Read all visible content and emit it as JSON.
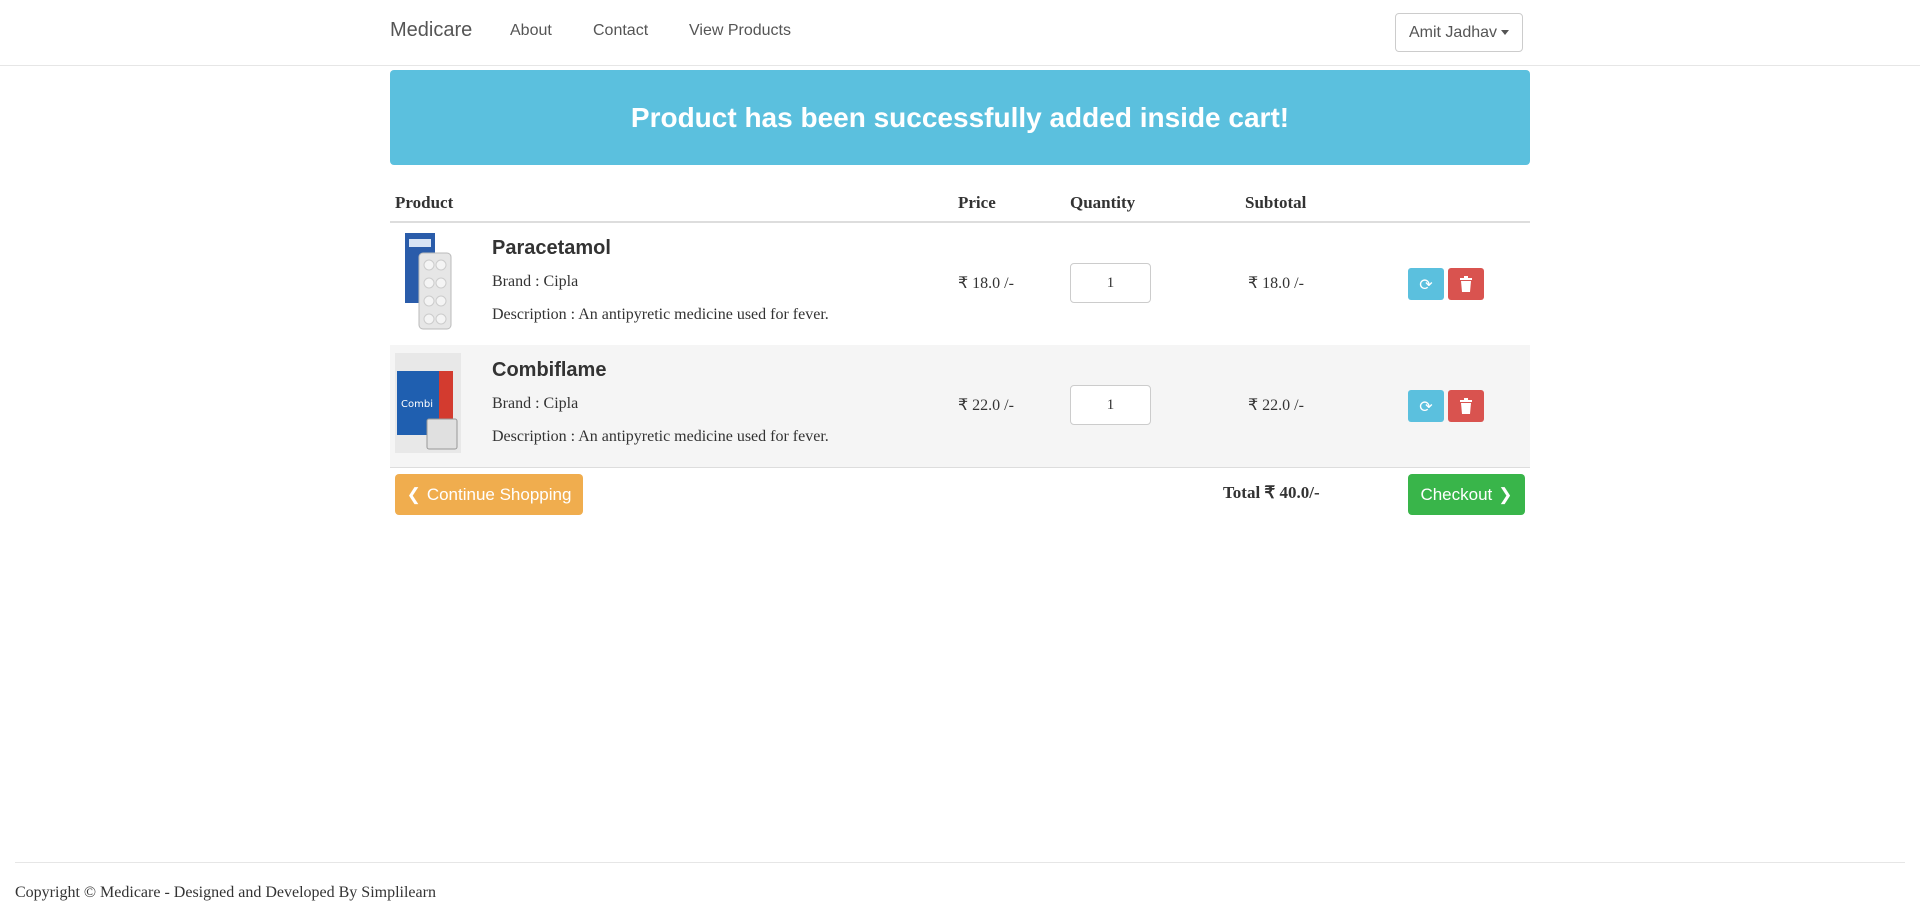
{
  "nav": {
    "brand": "Medicare",
    "links": [
      "About",
      "Contact",
      "View Products"
    ],
    "user": "Amit Jadhav"
  },
  "alert": {
    "message": "Product has been successfully added inside cart!"
  },
  "cart": {
    "headers": {
      "product": "Product",
      "price": "Price",
      "quantity": "Quantity",
      "subtotal": "Subtotal"
    },
    "items": [
      {
        "name": "Paracetamol",
        "brand": "Brand : Cipla",
        "description": "Description : An antipyretic medicine used for fever.",
        "price": "₹ 18.0 /-",
        "quantity": "1",
        "subtotal": "₹ 18.0 /-"
      },
      {
        "name": "Combiflame",
        "brand": "Brand : Cipla",
        "description": "Description : An antipyretic medicine used for fever.",
        "price": "₹ 22.0 /-",
        "quantity": "1",
        "subtotal": "₹ 22.0 /-"
      }
    ],
    "continue_label": "Continue Shopping",
    "total": "Total ₹ 40.0/-",
    "checkout_label": "Checkout"
  },
  "footer": {
    "text": "Copyright © Medicare - Designed and Developed By Simplilearn"
  },
  "colors": {
    "alert": "#5bc0de",
    "continue": "#f0ad4e",
    "checkout": "#39b54a",
    "refresh": "#5bc0de",
    "delete": "#d9534f"
  },
  "icons": [
    "refresh-icon",
    "trash-icon",
    "chevron-left-icon",
    "chevron-right-icon",
    "caret-down-icon"
  ]
}
